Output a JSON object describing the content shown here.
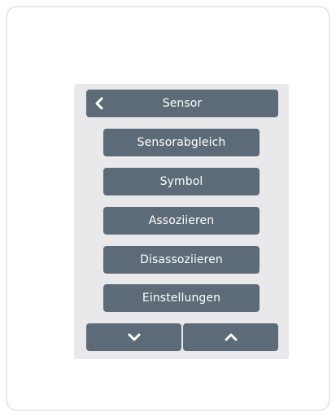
{
  "header": {
    "title": "Sensor",
    "back_icon": "chevron-left-icon"
  },
  "menu": {
    "items": [
      {
        "label": "Sensorabgleich"
      },
      {
        "label": "Symbol"
      },
      {
        "label": "Assoziieren"
      },
      {
        "label": "Disassoziieren"
      },
      {
        "label": "Einstellungen"
      }
    ]
  },
  "nav": {
    "down_icon": "chevron-down-icon",
    "up_icon": "chevron-up-icon"
  },
  "colors": {
    "button_bg": "#5d6b79",
    "screen_bg": "#e9e9eb",
    "text": "#ffffff"
  }
}
